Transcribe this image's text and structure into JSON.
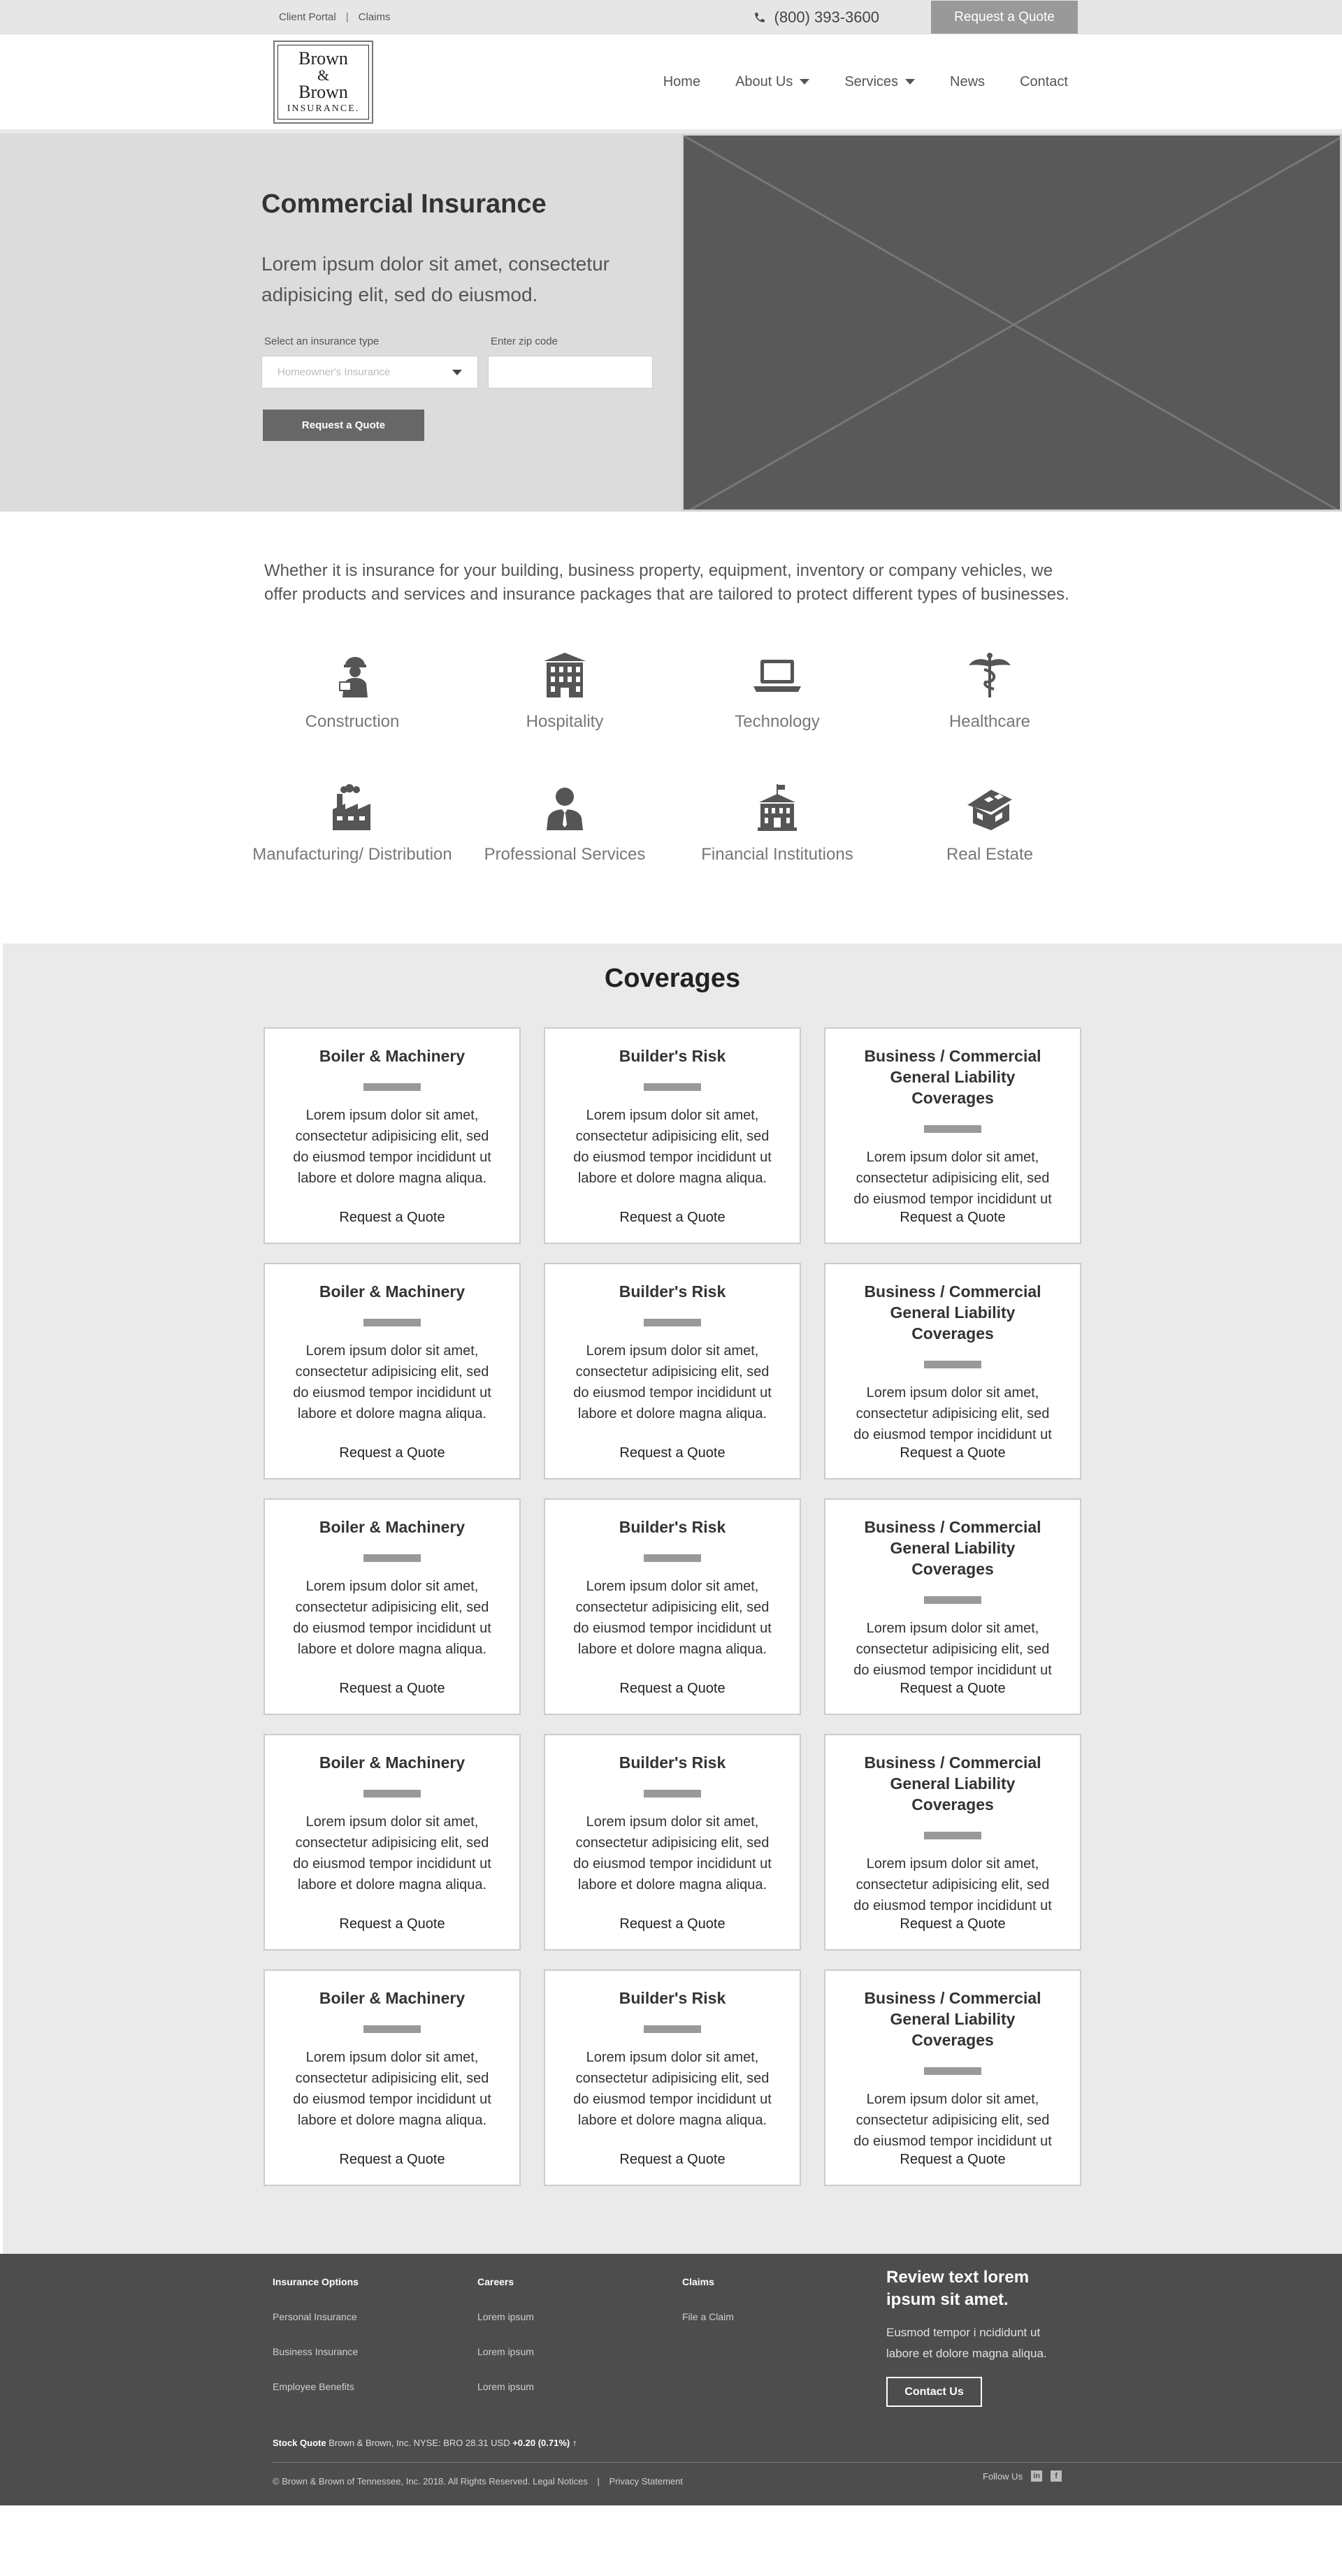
{
  "topbar": {
    "client_portal": "Client Portal",
    "separator": "|",
    "claims": "Claims",
    "phone": "(800) 393-3600",
    "quote_button": "Request a Quote"
  },
  "header": {
    "logo": {
      "line1": "Brown",
      "line2": "&",
      "line3": "Brown",
      "line4": "INSURANCE."
    },
    "nav": [
      {
        "label": "Home",
        "dropdown": false
      },
      {
        "label": "About Us",
        "dropdown": true
      },
      {
        "label": "Services",
        "dropdown": true
      },
      {
        "label": "News",
        "dropdown": false
      },
      {
        "label": "Contact",
        "dropdown": false
      }
    ]
  },
  "hero": {
    "title": "Commercial Insurance",
    "subtitle": "Lorem ipsum dolor sit amet, consectetur adipisicing elit, sed do eiusmod.",
    "type_label": "Select an insurance type",
    "type_value": "Homeowner's Insurance",
    "zip_label": "Enter zip code",
    "zip_value": "",
    "button": "Request a Quote"
  },
  "intro": "Whether it is insurance for your building, business property, equipment, inventory or company vehicles, we offer products and services and insurance packages that are tailored to protect different types of businesses.",
  "industries": [
    {
      "label": "Construction",
      "icon": "construction-worker-icon"
    },
    {
      "label": "Hospitality",
      "icon": "building-icon"
    },
    {
      "label": "Technology",
      "icon": "laptop-icon"
    },
    {
      "label": "Healthcare",
      "icon": "caduceus-icon"
    },
    {
      "label": "Manufacturing/ Distribution",
      "icon": "factory-icon"
    },
    {
      "label": "Professional Services",
      "icon": "businessman-icon"
    },
    {
      "label": "Financial Institutions",
      "icon": "bank-icon"
    },
    {
      "label": "Real Estate",
      "icon": "house-icon"
    }
  ],
  "coverages": {
    "title": "Coverages",
    "cards": [
      {
        "title": "Boiler & Machinery",
        "text": "Lorem ipsum dolor sit amet, consectetur adipisicing elit, sed do eiusmod tempor incididunt ut labore et dolore magna aliqua.",
        "link": "Request a Quote"
      },
      {
        "title": "Builder's Risk",
        "text": "Lorem ipsum dolor sit amet, consectetur adipisicing elit, sed do eiusmod tempor incididunt ut labore et dolore magna aliqua.",
        "link": "Request a Quote"
      },
      {
        "title": "Business / Commercial General Liability Coverages",
        "text": "Lorem ipsum dolor sit amet, consectetur adipisicing elit, sed do eiusmod tempor incididunt ut",
        "link": "Request a Quote"
      },
      {
        "title": "Boiler & Machinery",
        "text": "Lorem ipsum dolor sit amet, consectetur adipisicing elit, sed do eiusmod tempor incididunt ut labore et dolore magna aliqua.",
        "link": "Request a Quote"
      },
      {
        "title": "Builder's Risk",
        "text": "Lorem ipsum dolor sit amet, consectetur adipisicing elit, sed do eiusmod tempor incididunt ut labore et dolore magna aliqua.",
        "link": "Request a Quote"
      },
      {
        "title": "Business / Commercial General Liability Coverages",
        "text": "Lorem ipsum dolor sit amet, consectetur adipisicing elit, sed do eiusmod tempor incididunt ut",
        "link": "Request a Quote"
      },
      {
        "title": "Boiler & Machinery",
        "text": "Lorem ipsum dolor sit amet, consectetur adipisicing elit, sed do eiusmod tempor incididunt ut labore et dolore magna aliqua.",
        "link": "Request a Quote"
      },
      {
        "title": "Builder's Risk",
        "text": "Lorem ipsum dolor sit amet, consectetur adipisicing elit, sed do eiusmod tempor incididunt ut labore et dolore magna aliqua.",
        "link": "Request a Quote"
      },
      {
        "title": "Business / Commercial General Liability Coverages",
        "text": "Lorem ipsum dolor sit amet, consectetur adipisicing elit, sed do eiusmod tempor incididunt ut",
        "link": "Request a Quote"
      },
      {
        "title": "Boiler & Machinery",
        "text": "Lorem ipsum dolor sit amet, consectetur adipisicing elit, sed do eiusmod tempor incididunt ut labore et dolore magna aliqua.",
        "link": "Request a Quote"
      },
      {
        "title": "Builder's Risk",
        "text": "Lorem ipsum dolor sit amet, consectetur adipisicing elit, sed do eiusmod tempor incididunt ut labore et dolore magna aliqua.",
        "link": "Request a Quote"
      },
      {
        "title": "Business / Commercial General Liability Coverages",
        "text": "Lorem ipsum dolor sit amet, consectetur adipisicing elit, sed do eiusmod tempor incididunt ut",
        "link": "Request a Quote"
      },
      {
        "title": "Boiler & Machinery",
        "text": "Lorem ipsum dolor sit amet, consectetur adipisicing elit, sed do eiusmod tempor incididunt ut labore et dolore magna aliqua.",
        "link": "Request a Quote"
      },
      {
        "title": "Builder's Risk",
        "text": "Lorem ipsum dolor sit amet, consectetur adipisicing elit, sed do eiusmod tempor incididunt ut labore et dolore magna aliqua.",
        "link": "Request a Quote"
      },
      {
        "title": "Business / Commercial General Liability Coverages",
        "text": "Lorem ipsum dolor sit amet, consectetur adipisicing elit, sed do eiusmod tempor incididunt ut",
        "link": "Request a Quote"
      }
    ]
  },
  "footer": {
    "columns": [
      {
        "heading": "Insurance Options",
        "links": [
          "Personal Insurance",
          "Business Insurance",
          "Employee Benefits"
        ]
      },
      {
        "heading": "Careers",
        "links": [
          "Lorem ipsum",
          "Lorem ipsum",
          "Lorem ipsum"
        ]
      },
      {
        "heading": "Claims",
        "links": [
          "File a Claim"
        ]
      }
    ],
    "review_title": "Review text lorem ipsum sit amet.",
    "review_text": "Eusmod tempor i ncididunt ut labore et dolore magna aliqua.",
    "contact_button": "Contact Us",
    "stock_label": "Stock Quote",
    "stock_text": "Brown & Brown, Inc. NYSE: BRO 28.31 USD",
    "stock_change": "+0.20 (0.71%)",
    "stock_arrow": "↑",
    "copyright": "© Brown & Brown of Tennessee, Inc. 2018. All Rights Reserved. Legal Notices",
    "copyright_sep": "|",
    "privacy": "Privacy Statement",
    "follow": "Follow Us",
    "social": [
      "in",
      "f"
    ]
  },
  "colors": {
    "topbar": "#e6e6e6",
    "hero_bg": "#dcdcdc",
    "hero_image": "#595959",
    "button": "#676767",
    "coverage_bg": "#eaeaea",
    "footer_bg": "#4d4d4d"
  }
}
